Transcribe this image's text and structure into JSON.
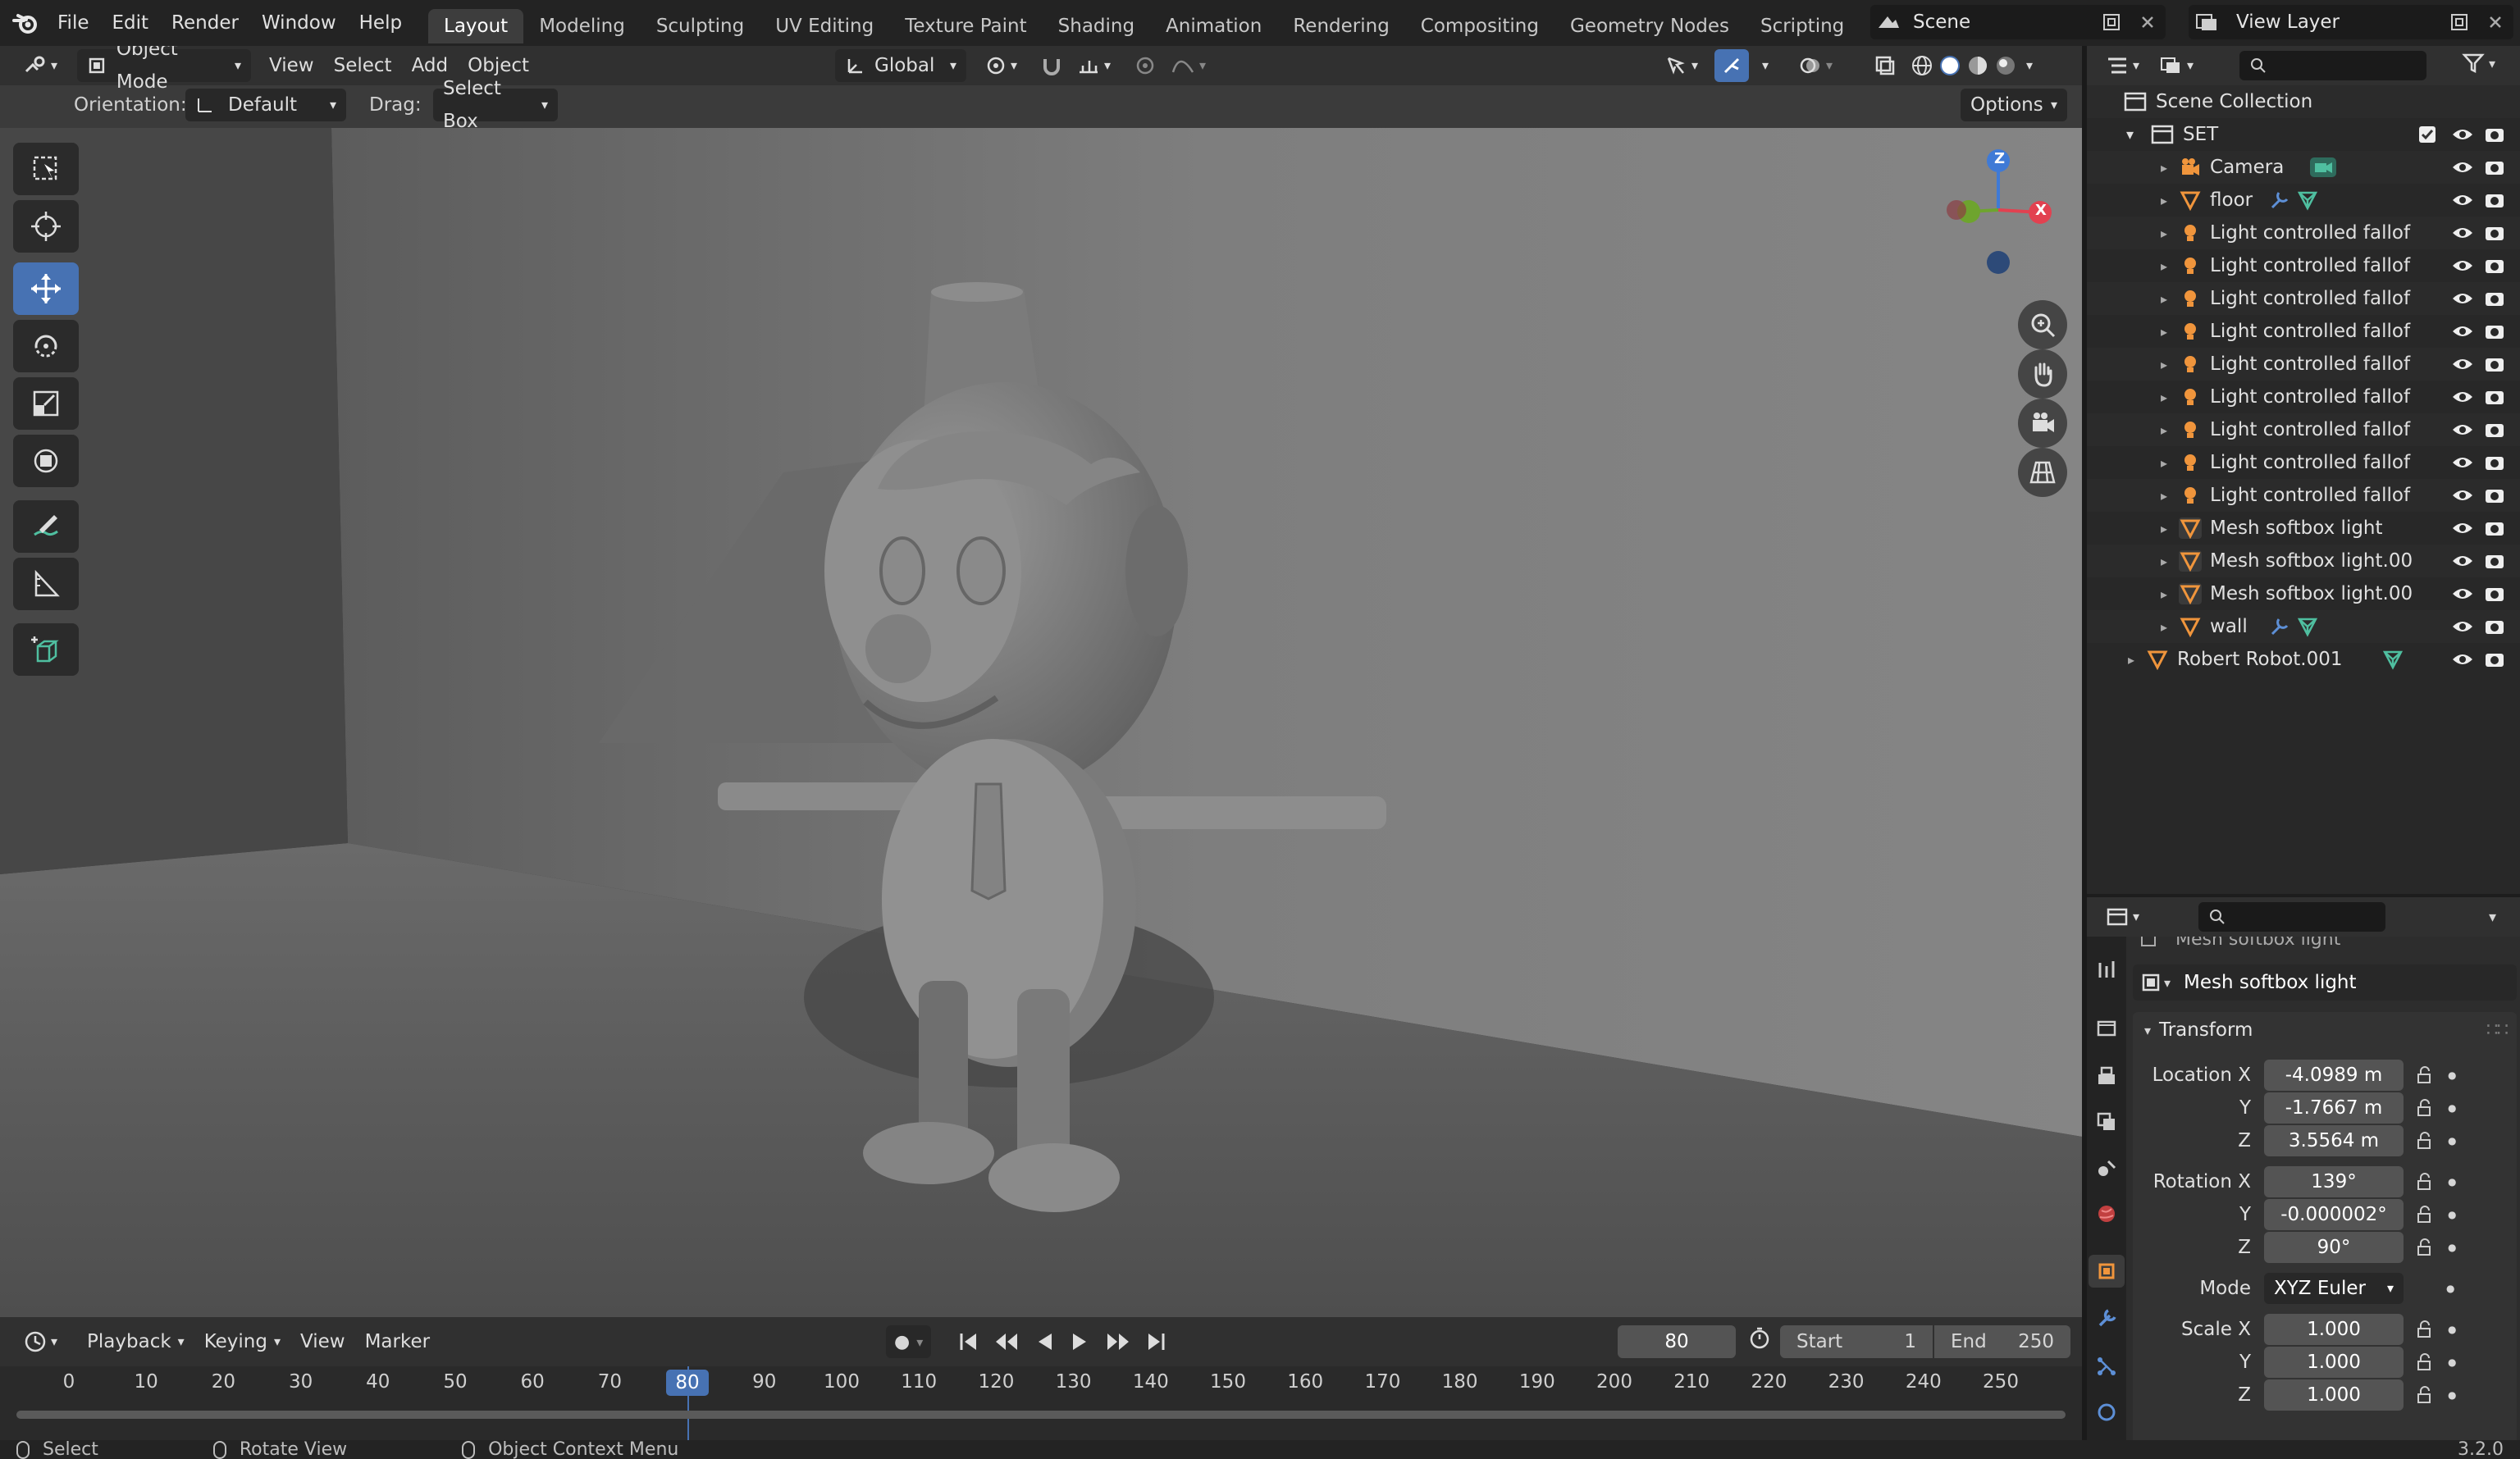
{
  "topbar": {
    "menus": [
      "File",
      "Edit",
      "Render",
      "Window",
      "Help"
    ],
    "workspaces": [
      "Layout",
      "Modeling",
      "Sculpting",
      "UV Editing",
      "Texture Paint",
      "Shading",
      "Animation",
      "Rendering",
      "Compositing",
      "Geometry Nodes",
      "Scripting"
    ],
    "active_workspace": "Layout",
    "add_tab": "+",
    "scene_name": "Scene",
    "view_layer_name": "View Layer"
  },
  "viewport_header": {
    "mode": "Object Mode",
    "menus": [
      "View",
      "Select",
      "Add",
      "Object"
    ],
    "transform_orientation": "Global",
    "orientation_label": "Orientation:",
    "orientation_value": "Default",
    "drag_label": "Drag:",
    "drag_value": "Select Box",
    "options_label": "Options"
  },
  "gizmo": {
    "z": "Z",
    "x": "X"
  },
  "outliner": {
    "root": "Scene Collection",
    "collection": "SET",
    "items": [
      {
        "name": "Camera",
        "type": "camera"
      },
      {
        "name": "floor",
        "type": "mesh"
      },
      {
        "name": "Light controlled fallof",
        "type": "light"
      },
      {
        "name": "Light controlled fallof",
        "type": "light"
      },
      {
        "name": "Light controlled fallof",
        "type": "light"
      },
      {
        "name": "Light controlled fallof",
        "type": "light"
      },
      {
        "name": "Light controlled fallof",
        "type": "light"
      },
      {
        "name": "Light controlled fallof",
        "type": "light"
      },
      {
        "name": "Light controlled fallof",
        "type": "light"
      },
      {
        "name": "Light controlled fallof",
        "type": "light"
      },
      {
        "name": "Light controlled fallof",
        "type": "light"
      },
      {
        "name": "Mesh softbox light",
        "type": "mesh"
      },
      {
        "name": "Mesh softbox light.00",
        "type": "mesh"
      },
      {
        "name": "Mesh softbox light.00",
        "type": "mesh"
      },
      {
        "name": "wall",
        "type": "mesh"
      }
    ],
    "robot": "Robert Robot.001"
  },
  "properties": {
    "clipped_header": "Mesh softbox light",
    "object_name": "Mesh softbox light",
    "panel_title": "Transform",
    "location": {
      "label": "Location X",
      "x": "-4.0989 m",
      "y": "-1.7667 m",
      "z": "3.5564 m"
    },
    "rotation": {
      "label": "Rotation X",
      "x": "139°",
      "y": "-0.000002°",
      "z": "90°"
    },
    "mode_label": "Mode",
    "mode_value": "XYZ Euler",
    "scale": {
      "label": "Scale X",
      "x": "1.000",
      "y": "1.000",
      "z": "1.000"
    },
    "y_label": "Y",
    "z_label": "Z"
  },
  "timeline": {
    "menus": [
      "Playback",
      "Keying",
      "View",
      "Marker"
    ],
    "current_frame": "80",
    "start_label": "Start",
    "start": "1",
    "end_label": "End",
    "end": "250",
    "ticks": [
      "0",
      "10",
      "20",
      "30",
      "40",
      "50",
      "60",
      "70",
      "80",
      "90",
      "100",
      "110",
      "120",
      "130",
      "140",
      "150",
      "160",
      "170",
      "180",
      "190",
      "200",
      "210",
      "220",
      "230",
      "240",
      "250"
    ]
  },
  "statusbar": {
    "select": "Select",
    "rotate": "Rotate View",
    "context": "Object Context Menu",
    "version": "3.2.0"
  },
  "colors": {
    "accent": "#4772b3",
    "light_icon": "#f0953c",
    "mesh_icon": "#f0953c",
    "data_icon": "#4fbfa0"
  }
}
